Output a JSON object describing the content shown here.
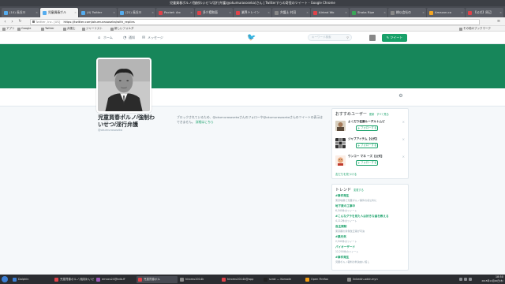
{
  "window": {
    "title": "児童買春ポルノ/強制わいせつ/淫行弁護(@okumurasoseka)さん | Twitterすらの奇怪のツイート - Google Chrome"
  },
  "tabs": [
    {
      "label": "(10) 長谷川",
      "color": "#55acee"
    },
    {
      "label": "児童買春ポル",
      "color": "#55acee",
      "active": true
    },
    {
      "label": "(4) Twitter",
      "color": "#55acee"
    },
    {
      "label": "(21) 長谷川",
      "color": "#55acee"
    },
    {
      "label": "Pocket: Arc",
      "color": "#e0434a"
    },
    {
      "label": "多少穏和面",
      "color": "#e0434a"
    },
    {
      "label": "業界トレイン",
      "color": "#e0434a"
    },
    {
      "label": "弁護士 村田",
      "color": "#888888"
    },
    {
      "label": "Airbnd Wo",
      "color": "#e0434a"
    },
    {
      "label": "Shaka Ripe",
      "color": "#3aa757"
    },
    {
      "label": "橋以会社の",
      "color": "#888888"
    },
    {
      "label": "Amazon.co",
      "color": "#f5a623"
    },
    {
      "label": "【公式】周辺",
      "color": "#e0434a"
    }
  ],
  "address": {
    "host": "Twitter, Inc. [US]",
    "url": "https://twitter.com/okumurasoseka/with_replies"
  },
  "bookmarks": [
    {
      "label": "アプリ"
    },
    {
      "label": "Google"
    },
    {
      "label": "Twitter"
    },
    {
      "label": "弁護士"
    },
    {
      "label": "ジャーリスト"
    },
    {
      "label": "新しいフォルダ"
    }
  ],
  "bookmarks_other": "その他のブックマーク",
  "twitter_nav": {
    "home": "ホーム",
    "notifications": "通知",
    "messages": "メッセージ",
    "search_placeholder": "キーワード検索",
    "tweet_button": "ツイート"
  },
  "profile": {
    "name": "児童買春ポルノ/強制わいせつ/淫行弁護",
    "handle": "@okumurasoseka"
  },
  "blocked": {
    "message": "ブロックされているため、@okumurasosekaさんのフォローや@okumurasosekaさんのツイートの表示はできません。",
    "learn_more": "詳細はこちら"
  },
  "who_to_follow": {
    "title": "おすすめユーザー",
    "refresh": "更新",
    "view_all": "すべて見る",
    "follow_label": "フォローする",
    "users": [
      {
        "name": "よくだり佐藤ルーデルトムピ"
      },
      {
        "name": "ジャブアイテム【公式】"
      },
      {
        "name": "ウンコー マネ ーズ【公式】"
      }
    ],
    "find_friends": "友だちを見つける"
  },
  "trends": {
    "title": "トレンド",
    "change": "変更する",
    "items": [
      {
        "name": "#事件発生",
        "desc": "東京地裁で児童ポルノ事件の初公判に"
      },
      {
        "name": "地下鉄の工事中",
        "desc": "6,340件のツイート"
      },
      {
        "name": "#こんなグラを見た人は好きな曲を教える",
        "desc": "4,112件のツイート"
      },
      {
        "name": "自主規制",
        "desc": "東京都の条例改正案が可決"
      },
      {
        "name": "#菓元気",
        "desc": "2,540件のツイート"
      },
      {
        "name": "パイオーザード",
        "desc": "12,200件のツイート"
      },
      {
        "name": "#事件発生",
        "desc": "児童ポルノ裁判の判決言い渡し"
      }
    ]
  },
  "taskbar": {
    "items": [
      {
        "label": "Dolphin",
        "color": "#3d7fd4"
      },
      {
        "label": "児童買春ポルノ/強制わいせつ",
        "color": "#e0434a"
      },
      {
        "label": "emacs24@kdb-ff",
        "color": "#9b59b6"
      },
      {
        "label": "児童買春ポル",
        "color": "#e0434a",
        "active": true
      },
      {
        "label": "hiromu2014k",
        "color": "#888888"
      },
      {
        "label": "hiromu2014k@app",
        "color": "#e0434a"
      },
      {
        "label": "scrot — Konsole",
        "color": "#222222"
      },
      {
        "label": "Open Firefox",
        "color": "#f39c12"
      },
      {
        "label": "linkedin-addr-myn",
        "color": "#888888"
      }
    ],
    "time": "18:50",
    "date": "2015年11月20日(木)"
  },
  "colors": {
    "banner": "#17865a",
    "accent": "#19a16a",
    "twitter_blue": "#55acee"
  }
}
